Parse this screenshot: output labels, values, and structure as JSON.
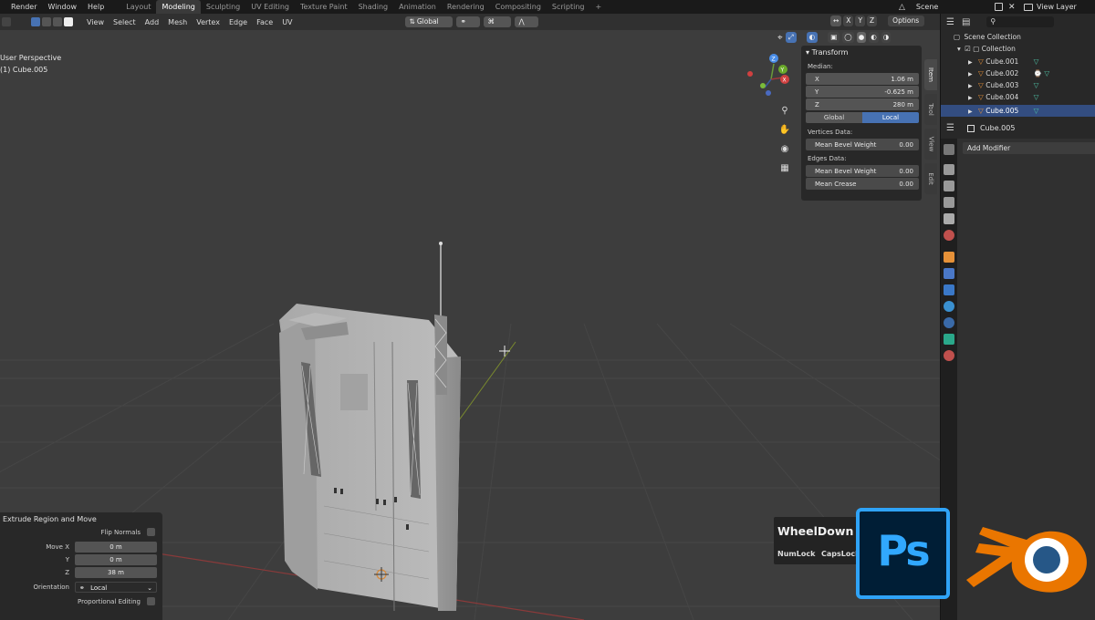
{
  "menus": [
    "Render",
    "Window",
    "Help"
  ],
  "workspaces": [
    {
      "label": "Layout",
      "active": false
    },
    {
      "label": "Modeling",
      "active": true
    },
    {
      "label": "Sculpting",
      "active": false
    },
    {
      "label": "UV Editing",
      "active": false
    },
    {
      "label": "Texture Paint",
      "active": false
    },
    {
      "label": "Shading",
      "active": false
    },
    {
      "label": "Animation",
      "active": false
    },
    {
      "label": "Rendering",
      "active": false
    },
    {
      "label": "Compositing",
      "active": false
    },
    {
      "label": "Scripting",
      "active": false
    }
  ],
  "add_workspace": "+",
  "scene": {
    "name": "Scene",
    "view_layer": "View Layer"
  },
  "viewport_header": {
    "menus": [
      "View",
      "Select",
      "Add",
      "Mesh",
      "Vertex",
      "Edge",
      "Face",
      "UV"
    ],
    "orientation": "Global",
    "axes": [
      "X",
      "Y",
      "Z"
    ],
    "options": "Options"
  },
  "viewport_info": {
    "line1": "User Perspective",
    "line2": "(1) Cube.005"
  },
  "npanel": {
    "section": "Transform",
    "median_label": "Median:",
    "fields": [
      {
        "axis": "X",
        "value": "1.06 m"
      },
      {
        "axis": "Y",
        "value": "-0.625 m"
      },
      {
        "axis": "Z",
        "value": "280 m"
      }
    ],
    "space": [
      "Global",
      "Local"
    ],
    "space_active": "Local",
    "vertices_label": "Vertices Data:",
    "vertex_fields": [
      {
        "label": "Mean Bevel Weight",
        "value": "0.00"
      }
    ],
    "edges_label": "Edges Data:",
    "edge_fields": [
      {
        "label": "Mean Bevel Weight",
        "value": "0.00"
      },
      {
        "label": "Mean Crease",
        "value": "0.00"
      }
    ],
    "tabs": [
      "Item",
      "Tool",
      "View",
      "Edit"
    ],
    "tab_active": "Item"
  },
  "redo_panel": {
    "title": "Extrude Region and Move",
    "flip_normals": "Flip Normals",
    "move_x_label": "Move X",
    "move_x": "0 m",
    "y_label": "Y",
    "y": "0 m",
    "z_label": "Z",
    "z": "38 m",
    "orientation_label": "Orientation",
    "orientation": "Local",
    "proportional": "Proportional Editing"
  },
  "keys": {
    "event": "WheelDown",
    "mod1": "NumLock",
    "mod2": "CapsLock"
  },
  "outliner": {
    "root": "Scene Collection",
    "collection": "Collection",
    "objects": [
      {
        "name": "Cube.001",
        "selected": false
      },
      {
        "name": "Cube.002",
        "selected": false
      },
      {
        "name": "Cube.003",
        "selected": false
      },
      {
        "name": "Cube.004",
        "selected": false
      },
      {
        "name": "Cube.005",
        "selected": true
      }
    ]
  },
  "properties": {
    "object": "Cube.005",
    "add_modifier": "Add Modifier"
  },
  "logos": {
    "photoshop": "Ps"
  },
  "colors": {
    "accent": "#4772b3",
    "selection": "#334d80",
    "bg": "#3d3d3d",
    "ps_blue": "#31a8ff",
    "blender_orange": "#ea7600",
    "blender_blue": "#265787"
  }
}
